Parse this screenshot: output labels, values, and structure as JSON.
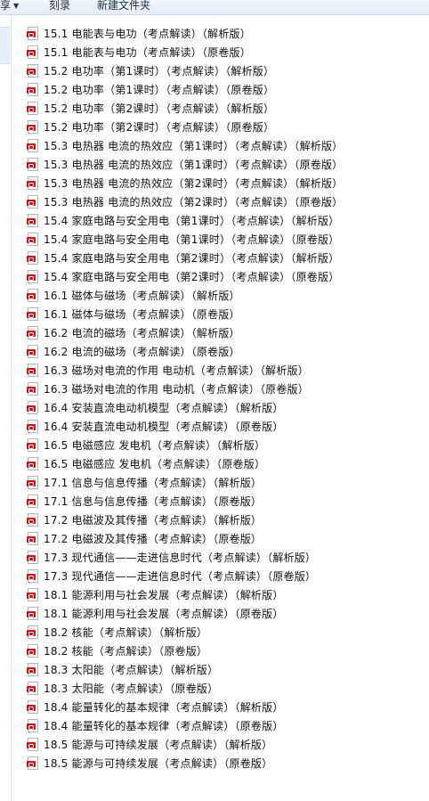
{
  "toolbar": {
    "share_label": "享",
    "burn_label": "刻录",
    "new_folder_label": "新建文件夹"
  },
  "files": [
    "15.1 电能表与电功（考点解读）（解析版）",
    "15.1 电能表与电功（考点解读）（原卷版）",
    "15.2 电功率（第1课时）（考点解读）（解析版）",
    "15.2 电功率（第1课时）（考点解读）（原卷版）",
    "15.2 电功率（第2课时）（考点解读）（解析版）",
    "15.2 电功率（第2课时）（考点解读）（原卷版）",
    "15.3 电热器 电流的热效应（第1课时）（考点解读）（解析版）",
    "15.3 电热器 电流的热效应（第1课时）（考点解读）（原卷版）",
    "15.3 电热器 电流的热效应（第2课时）（考点解读）（解析版）",
    "15.3 电热器 电流的热效应（第2课时）（考点解读）（原卷版）",
    "15.4 家庭电路与安全用电（第1课时）（考点解读）（解析版）",
    "15.4 家庭电路与安全用电（第1课时）（考点解读）（原卷版）",
    "15.4 家庭电路与安全用电（第2课时）（考点解读）（解析版）",
    "15.4 家庭电路与安全用电（第2课时）（考点解读）（原卷版）",
    "16.1 磁体与磁场（考点解读）（解析版）",
    "16.1 磁体与磁场（考点解读）（原卷版）",
    "16.2 电流的磁场（考点解读）（解析版）",
    "16.2 电流的磁场（考点解读）（原卷版）",
    "16.3 磁场对电流的作用 电动机（考点解读）（解析版）",
    "16.3 磁场对电流的作用 电动机（考点解读）（原卷版）",
    "16.4 安装直流电动机模型（考点解读）（解析版）",
    "16.4 安装直流电动机模型（考点解读）（原卷版）",
    "16.5 电磁感应 发电机（考点解读）（解析版）",
    "16.5 电磁感应 发电机（考点解读）（原卷版）",
    "17.1  信息与信息传播（考点解读）（解析版）",
    "17.1  信息与信息传播（考点解读）（原卷版）",
    "17.2 电磁波及其传播（考点解读）（解析版）",
    "17.2 电磁波及其传播（考点解读）（原卷版）",
    "17.3 现代通信——走进信息时代（考点解读）（解析版）",
    "17.3 现代通信——走进信息时代（考点解读）（原卷版）",
    "18.1 能源利用与社会发展（考点解读）（解析版）",
    "18.1 能源利用与社会发展（考点解读）（原卷版）",
    "18.2 核能（考点解读）（解析版）",
    "18.2 核能（考点解读）（原卷版）",
    "18.3 太阳能（考点解读）（解析版）",
    "18.3 太阳能（考点解读）（原卷版）",
    "18.4 能量转化的基本规律（考点解读）（解析版）",
    "18.4 能量转化的基本规律（考点解读）（原卷版）",
    "18.5 能源与可持续发展（考点解读）（解析版）",
    "18.5 能源与可持续发展（考点解读）（原卷版）"
  ],
  "file_icon": "pdf-file-icon"
}
